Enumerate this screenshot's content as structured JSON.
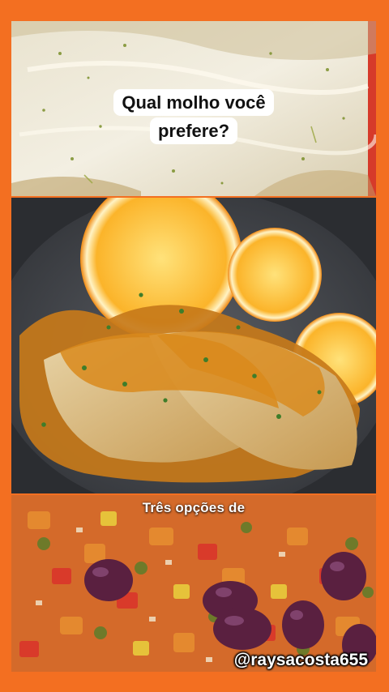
{
  "overlay": {
    "question_line1": "Qual molho você",
    "question_line2": "prefere?",
    "caption": "Três opções de",
    "handle": "@raysacosta655"
  },
  "colors": {
    "frame": "#f36f21",
    "caption_text": "#ffffff",
    "question_bg": "#ffffff"
  },
  "panels": [
    {
      "name": "fish-with-white-sauce"
    },
    {
      "name": "fish-with-orange-sauce"
    },
    {
      "name": "vegetable-olive-relish"
    }
  ]
}
